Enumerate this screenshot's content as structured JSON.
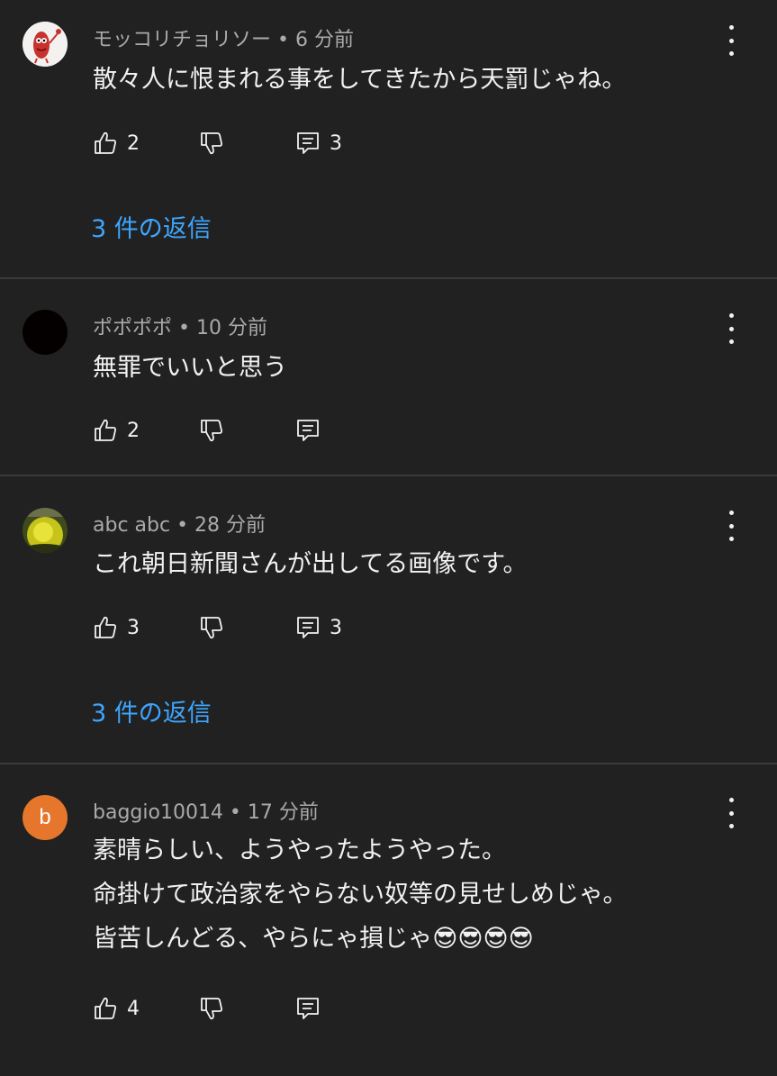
{
  "comments": [
    {
      "author": "モッコリチョリソー",
      "time": "6 分前",
      "lines": [
        "散々人に恨まれる事をしてきたから天罰じゃね。"
      ],
      "likes": "2",
      "replies_count": "3",
      "replies_link": "3 件の返信",
      "avatar": "sausage-character-avatar"
    },
    {
      "author": "ポポポポ",
      "time": "10 分前",
      "lines": [
        "無罪でいいと思う"
      ],
      "likes": "2",
      "replies_count": "",
      "replies_link": "",
      "avatar": "black-circle-avatar"
    },
    {
      "author": "abc abc",
      "time": "28 分前",
      "lines": [
        "これ朝日新聞さんが出してる画像です。"
      ],
      "likes": "3",
      "replies_count": "3",
      "replies_link": "3 件の返信",
      "avatar": "yellow-photo-avatar"
    },
    {
      "author": "baggio10014",
      "time": "17 分前",
      "lines": [
        "素晴らしい、ようやったようやった。",
        "命掛けて政治家をやらない奴等の見せしめじゃ。",
        "皆苦しんどる、やらにゃ損じゃ😎😎😎😎"
      ],
      "likes": "4",
      "replies_count": "",
      "replies_link": "",
      "avatar_letter": "b"
    }
  ],
  "separator": " • ",
  "colors": {
    "background": "#212121",
    "link": "#3ea6ff",
    "meta": "#aaaaaa",
    "text": "#f1f1f1",
    "letter_avatar": "#e5762c"
  }
}
